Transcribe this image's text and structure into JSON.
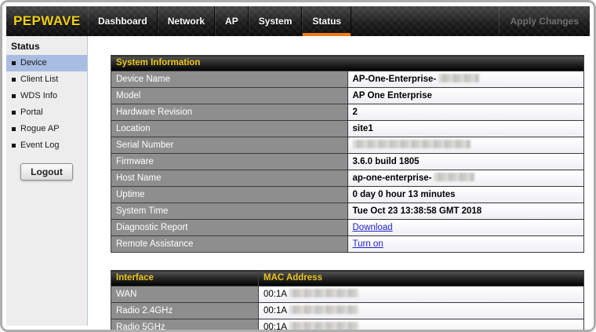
{
  "header": {
    "logo": "PEPWAVE",
    "nav": [
      {
        "label": "Dashboard",
        "active": false
      },
      {
        "label": "Network",
        "active": false
      },
      {
        "label": "AP",
        "active": false
      },
      {
        "label": "System",
        "active": false
      },
      {
        "label": "Status",
        "active": true
      }
    ],
    "apply_changes_label": "Apply Changes"
  },
  "sidebar": {
    "title": "Status",
    "items": [
      {
        "label": "Device",
        "selected": true
      },
      {
        "label": "Client List",
        "selected": false
      },
      {
        "label": "WDS Info",
        "selected": false
      },
      {
        "label": "Portal",
        "selected": false
      },
      {
        "label": "Rogue AP",
        "selected": false
      },
      {
        "label": "Event Log",
        "selected": false
      }
    ],
    "logout_label": "Logout"
  },
  "system_info": {
    "title": "System Information",
    "rows": [
      {
        "label": "Device Name",
        "value": "AP-One-Enterprise-",
        "redacted": true,
        "link": false
      },
      {
        "label": "Model",
        "value": "AP One Enterprise",
        "redacted": false,
        "link": false
      },
      {
        "label": "Hardware Revision",
        "value": "2",
        "redacted": false,
        "link": false
      },
      {
        "label": "Location",
        "value": "site1",
        "redacted": false,
        "link": false
      },
      {
        "label": "Serial Number",
        "value": "",
        "redacted": true,
        "link": false
      },
      {
        "label": "Firmware",
        "value": "3.6.0 build 1805",
        "redacted": false,
        "link": false
      },
      {
        "label": "Host Name",
        "value": "ap-one-enterprise-",
        "redacted": true,
        "link": false
      },
      {
        "label": "Uptime",
        "value": "0 day 0 hour 13 minutes",
        "redacted": false,
        "link": false
      },
      {
        "label": "System Time",
        "value": "Tue Oct 23 13:38:58 GMT 2018",
        "redacted": false,
        "link": false
      },
      {
        "label": "Diagnostic Report",
        "value": "Download",
        "redacted": false,
        "link": true
      },
      {
        "label": "Remote Assistance",
        "value": "Turn on",
        "redacted": false,
        "link": true
      }
    ]
  },
  "interface_table": {
    "col1_header": "Interface",
    "col2_header": "MAC Address",
    "rows": [
      {
        "label": "WAN",
        "value": "00:1A",
        "redacted": true
      },
      {
        "label": "Radio 2.4GHz",
        "value": "00:1A",
        "redacted": true
      },
      {
        "label": "Radio 5GHz",
        "value": "00:1A",
        "redacted": true
      }
    ]
  },
  "colors": {
    "accent_orange": "#ed7d17",
    "logo_yellow": "#f2d011",
    "table_header_yellow": "#edc61a",
    "label_cell_gray": "#8e8e8e",
    "selected_item_blue": "#a9bde2",
    "link_blue": "#2222cc"
  }
}
